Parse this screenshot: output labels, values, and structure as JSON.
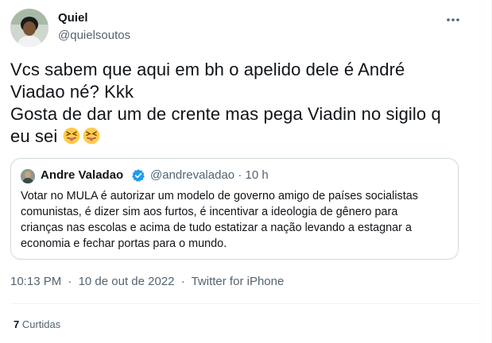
{
  "author": {
    "name": "Quiel",
    "handle": "@quielsoutos"
  },
  "tweet": {
    "lines": [
      "Vcs sabem que aqui em bh o apelido dele é André",
      "Viadao né? Kkk",
      "Gosta de dar um de crente mas pega Viadin no sigilo q",
      "eu sei"
    ],
    "emoji": [
      "squinting-tongue-emoji",
      "squinting-tongue-emoji"
    ]
  },
  "quoted": {
    "name": "Andre Valadao",
    "handle": "@andrevaladao",
    "dot": "·",
    "time": "10 h",
    "lines": [
      "Votar no MULA é autorizar um modelo de governo amigo de países socialistas",
      "comunistas, é dizer sim aos furtos, é incentivar a ideologia de gênero para",
      "crianças nas escolas e acima de tudo estatizar a nação levando a estagnar a",
      "economia e fechar portas para o mundo."
    ]
  },
  "meta": {
    "time": "10:13 PM",
    "dot1": "·",
    "date": "10 de out de 2022",
    "dot2": "·",
    "source": "Twitter for iPhone"
  },
  "stats": {
    "count": "7",
    "label": "Curtidas"
  },
  "colors": {
    "secondary_text": "#536471",
    "border": "#cfd9de",
    "verified": "#1d9bf0",
    "emoji": "#ffcc4d",
    "tongue": "#e8596e"
  }
}
